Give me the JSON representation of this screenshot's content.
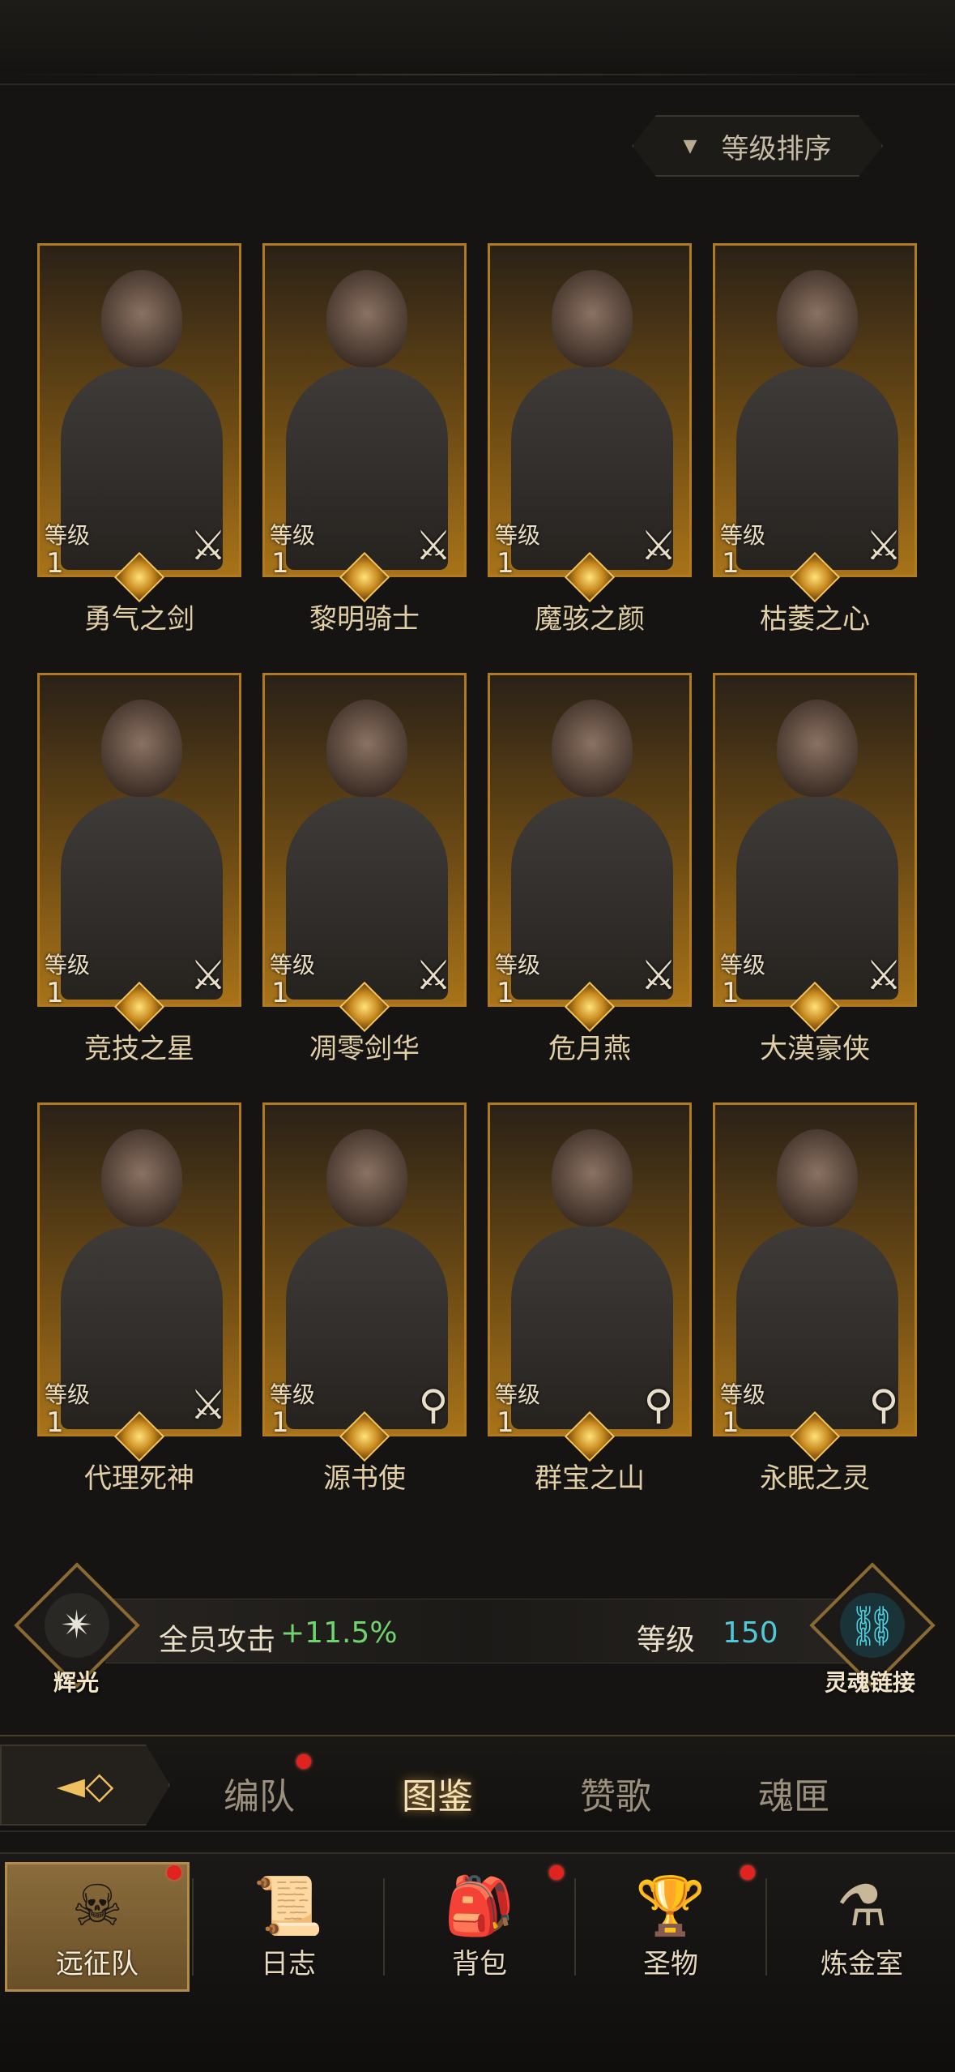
{
  "sort_button": {
    "label": "等级排序"
  },
  "heroes": [
    {
      "name": "勇气之剑",
      "level_label": "等级",
      "level": "1",
      "type_icon": "sword-icon"
    },
    {
      "name": "黎明骑士",
      "level_label": "等级",
      "level": "1",
      "type_icon": "sword-icon"
    },
    {
      "name": "魔骇之颜",
      "level_label": "等级",
      "level": "1",
      "type_icon": "sword-icon"
    },
    {
      "name": "枯萎之心",
      "level_label": "等级",
      "level": "1",
      "type_icon": "sword-icon"
    },
    {
      "name": "竞技之星",
      "level_label": "等级",
      "level": "1",
      "type_icon": "sword-icon"
    },
    {
      "name": "凋零剑华",
      "level_label": "等级",
      "level": "1",
      "type_icon": "sword-icon"
    },
    {
      "name": "危月燕",
      "level_label": "等级",
      "level": "1",
      "type_icon": "sword-icon"
    },
    {
      "name": "大漠豪侠",
      "level_label": "等级",
      "level": "1",
      "type_icon": "sword-icon"
    },
    {
      "name": "代理死神",
      "level_label": "等级",
      "level": "1",
      "type_icon": "sword-icon"
    },
    {
      "name": "源书使",
      "level_label": "等级",
      "level": "1",
      "type_icon": "staff-icon"
    },
    {
      "name": "群宝之山",
      "level_label": "等级",
      "level": "1",
      "type_icon": "staff-icon"
    },
    {
      "name": "永眠之灵",
      "level_label": "等级",
      "level": "1",
      "type_icon": "staff-icon"
    }
  ],
  "bonus": {
    "left_emblem_label": "辉光",
    "stat_label": "全员攻击",
    "stat_value": "+11.5%",
    "level_label": "等级",
    "level_value": "150",
    "right_emblem_label": "灵魂链接"
  },
  "tabs": [
    {
      "label": "编队",
      "active": false,
      "badge": true
    },
    {
      "label": "图鉴",
      "active": true,
      "badge": false
    },
    {
      "label": "赞歌",
      "active": false,
      "badge": false
    },
    {
      "label": "魂匣",
      "active": false,
      "badge": false
    }
  ],
  "nav": [
    {
      "label": "远征队",
      "icon": "viking-helmet-icon",
      "active": true,
      "badge": true
    },
    {
      "label": "日志",
      "icon": "scroll-icon",
      "active": false,
      "badge": false
    },
    {
      "label": "背包",
      "icon": "bag-icon",
      "active": false,
      "badge": true
    },
    {
      "label": "圣物",
      "icon": "chalice-icon",
      "active": false,
      "badge": true
    },
    {
      "label": "炼金室",
      "icon": "alchemy-icon",
      "active": false,
      "badge": false
    }
  ],
  "colors": {
    "card_border": "#b07a22",
    "stat_value": "#6fd36f",
    "level_value": "#4fc8d8",
    "badge": "#e0231f"
  }
}
